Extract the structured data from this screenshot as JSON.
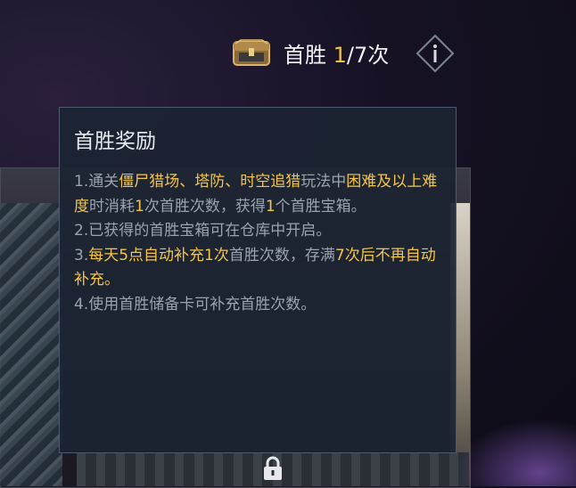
{
  "header": {
    "title": "首胜",
    "current": "1",
    "suffix": "/7次",
    "chest_icon": "chest-icon",
    "info_icon": "info-icon"
  },
  "tooltip": {
    "title": "首胜奖励",
    "rules": [
      {
        "segments": [
          {
            "text": "1.通关",
            "hl": false
          },
          {
            "text": "僵尸猎场、塔防、时空追猎",
            "hl": true
          },
          {
            "text": "玩法中",
            "hl": false
          },
          {
            "text": "困难及以上难度",
            "hl": true
          },
          {
            "text": "时消耗",
            "hl": false
          },
          {
            "text": "1",
            "hl": true
          },
          {
            "text": "次首胜次数，获得",
            "hl": false
          },
          {
            "text": "1",
            "hl": true
          },
          {
            "text": "个首胜宝箱。",
            "hl": false
          }
        ]
      },
      {
        "segments": [
          {
            "text": "2.已获得的首胜宝箱可在仓库中开启。",
            "hl": false
          }
        ]
      },
      {
        "segments": [
          {
            "text": "3.",
            "hl": false
          },
          {
            "text": "每天5点自动补充1次",
            "hl": true
          },
          {
            "text": "首胜次数，存满",
            "hl": false
          },
          {
            "text": "7次后不再自动补充。",
            "hl": true
          }
        ]
      },
      {
        "segments": [
          {
            "text": "4.使用首胜储备卡可补充首胜次数。",
            "hl": false
          }
        ]
      }
    ]
  },
  "background": {
    "lock_icon": "lock-icon"
  },
  "colors": {
    "highlight": "#f4c54a",
    "body_text": "#9aa3ae",
    "panel_bg": "#1c2432"
  }
}
